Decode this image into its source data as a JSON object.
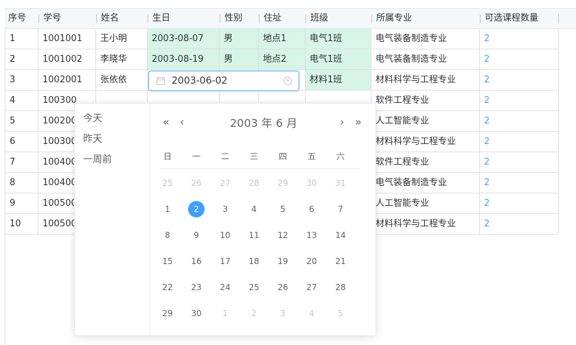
{
  "table": {
    "headers": [
      "序号",
      "学号",
      "姓名",
      "生日",
      "性别",
      "住址",
      "班级",
      "所属专业",
      "可选课程数量"
    ],
    "rows": [
      [
        "1",
        "1001001",
        "王小明",
        "2003-08-07",
        "男",
        "地点1",
        "电气1班",
        "电气装备制造专业",
        "2"
      ],
      [
        "2",
        "1001002",
        "李晓华",
        "2003-08-19",
        "男",
        "地点2",
        "电气1班",
        "电气装备制造专业",
        "2"
      ],
      [
        "3",
        "1002001",
        "张依依",
        "",
        "",
        "",
        "材料1班",
        "材料科学与工程专业",
        "2"
      ],
      [
        "4",
        "100300",
        "",
        "",
        "",
        "",
        "",
        "软件工程专业",
        "2"
      ],
      [
        "5",
        "100200",
        "",
        "",
        "",
        "",
        "",
        "人工智能专业",
        "2"
      ],
      [
        "6",
        "100300",
        "",
        "",
        "",
        "",
        "",
        "材料科学与工程专业",
        "2"
      ],
      [
        "7",
        "100400",
        "",
        "",
        "",
        "",
        "",
        "软件工程专业",
        "2"
      ],
      [
        "8",
        "100400",
        "",
        "",
        "",
        "",
        "",
        "电气装备制造专业",
        "2"
      ],
      [
        "9",
        "100500",
        "",
        "",
        "",
        "",
        "",
        "人工智能专业",
        "2"
      ],
      [
        "10",
        "100500",
        "",
        "",
        "",
        "",
        "",
        "材料科学与工程专业",
        "2"
      ]
    ]
  },
  "date_input": {
    "value": "2003-06-02"
  },
  "picker": {
    "shortcuts": [
      "今天",
      "昨天",
      "一周前"
    ],
    "nav": {
      "prev_year": "«",
      "prev_month": "‹",
      "next_month": "›",
      "next_year": "»"
    },
    "title": "2003 年  6 月",
    "weekdays": [
      "日",
      "一",
      "二",
      "三",
      "四",
      "五",
      "六"
    ],
    "weeks": [
      [
        "25",
        "26",
        "27",
        "28",
        "29",
        "30",
        "31"
      ],
      [
        "1",
        "2",
        "3",
        "4",
        "5",
        "6",
        "7"
      ],
      [
        "8",
        "9",
        "10",
        "11",
        "12",
        "13",
        "14"
      ],
      [
        "15",
        "16",
        "17",
        "18",
        "19",
        "20",
        "21"
      ],
      [
        "22",
        "23",
        "24",
        "25",
        "26",
        "27",
        "28"
      ],
      [
        "29",
        "30",
        "1",
        "2",
        "3",
        "4",
        "5"
      ]
    ],
    "selected": "2"
  },
  "colors": {
    "accent": "#409eff",
    "green_cell": "#d6f5e6"
  }
}
